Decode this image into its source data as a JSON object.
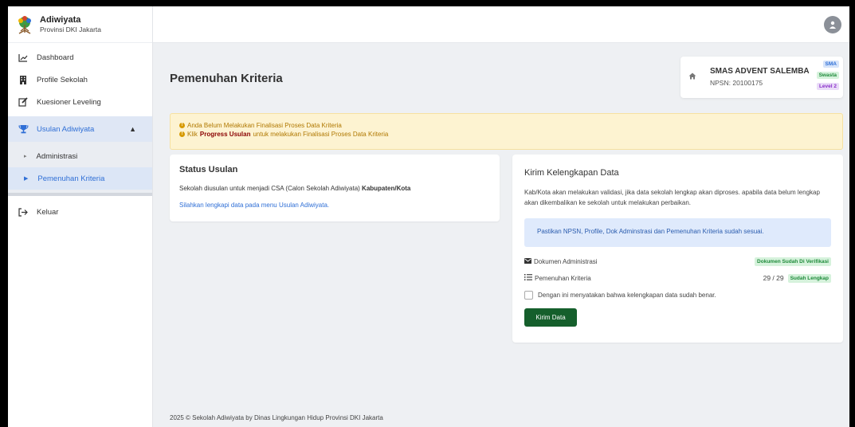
{
  "brand": {
    "name": "Adiwiyata",
    "subtitle": "Provinsi DKI Jakarta"
  },
  "sidebar": {
    "items": [
      {
        "label": "Dashboard",
        "icon": "chart-line-icon"
      },
      {
        "label": "Profile Sekolah",
        "icon": "building-icon"
      },
      {
        "label": "Kuesioner Leveling",
        "icon": "edit-icon"
      },
      {
        "label": "Usulan Adiwiyata",
        "icon": "trophy-icon"
      }
    ],
    "sub_items": [
      {
        "label": "Administrasi"
      },
      {
        "label": "Pemenuhan Kriteria"
      }
    ],
    "logout": {
      "label": "Keluar",
      "icon": "logout-icon"
    }
  },
  "page": {
    "title": "Pemenuhan Kriteria"
  },
  "school": {
    "name": "SMAS ADVENT SALEMBA",
    "npsn": "NPSN: 20100175",
    "badges": {
      "level": "SMA",
      "type": "Swasta",
      "stage": "Level 2"
    }
  },
  "alert": {
    "line1": "Anda Belum Melakukan Finalisasi Proses Data Kriteria",
    "line2_prefix": "Klik",
    "line2_bold": "Progress Usulan",
    "line2_suffix": "untuk melakukan Finalisasi Proses Data Kriteria"
  },
  "status_card": {
    "title": "Status Usulan",
    "text_prefix": "Sekolah diusulan untuk menjadi CSA (Calon Sekolah Adiwiyata)",
    "text_bold": "Kabupaten/Kota",
    "link": "Silahkan lengkapi data pada menu Usulan Adiwiyata."
  },
  "send_card": {
    "title": "Kirim Kelengkapan Data",
    "description": "Kab/Kota akan melakukan validasi, jika data sekolah lengkap akan diproses. apabila data belum lengkap akan dikembalikan ke sekolah untuk melakukan perbaikan.",
    "info": "Pastikan NPSN, Profile, Dok Adminstrasi dan Pemenuhan Kriteria sudah sesuai.",
    "doc_label": "Dokumen Administrasi",
    "doc_status": "Dokumen Sudah Di Verifikasi",
    "criteria_label": "Pemenuhan Kriteria",
    "criteria_count": "29 / 29",
    "criteria_status": "Sudah Lengkap",
    "checkbox_label": "Dengan ini menyatakan bahwa kelengkapan data sudah benar.",
    "button": "Kirim Data"
  },
  "footer": "2025 © Sekolah Adiwiyata by Dinas Lingkungan Hidup Provinsi DKI Jakarta"
}
